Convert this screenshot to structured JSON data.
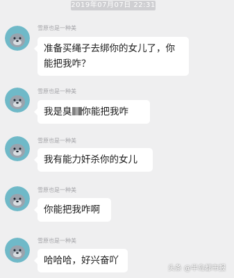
{
  "timestamp": "2019年07月07日 22:31",
  "sender_name": "雪原也是一种美",
  "messages": [
    {
      "text": "准备买绳子去绑你的女儿了，你能把我咋？"
    },
    {
      "text_before": "我是臭",
      "text_after": "你能把我咋"
    },
    {
      "text": "我有能力奸杀你的女儿"
    },
    {
      "text": "你能把我咋啊"
    },
    {
      "text": "哈哈哈，好兴奋吖"
    }
  ],
  "watermark": "头条 @半岛都市报",
  "colors": {
    "background": "#efeff0",
    "bubble": "#ffffff",
    "timestamp_pill": "#cfcfd2",
    "avatar_bg": "#6fb9c8",
    "seal": "#9aa3ad"
  }
}
